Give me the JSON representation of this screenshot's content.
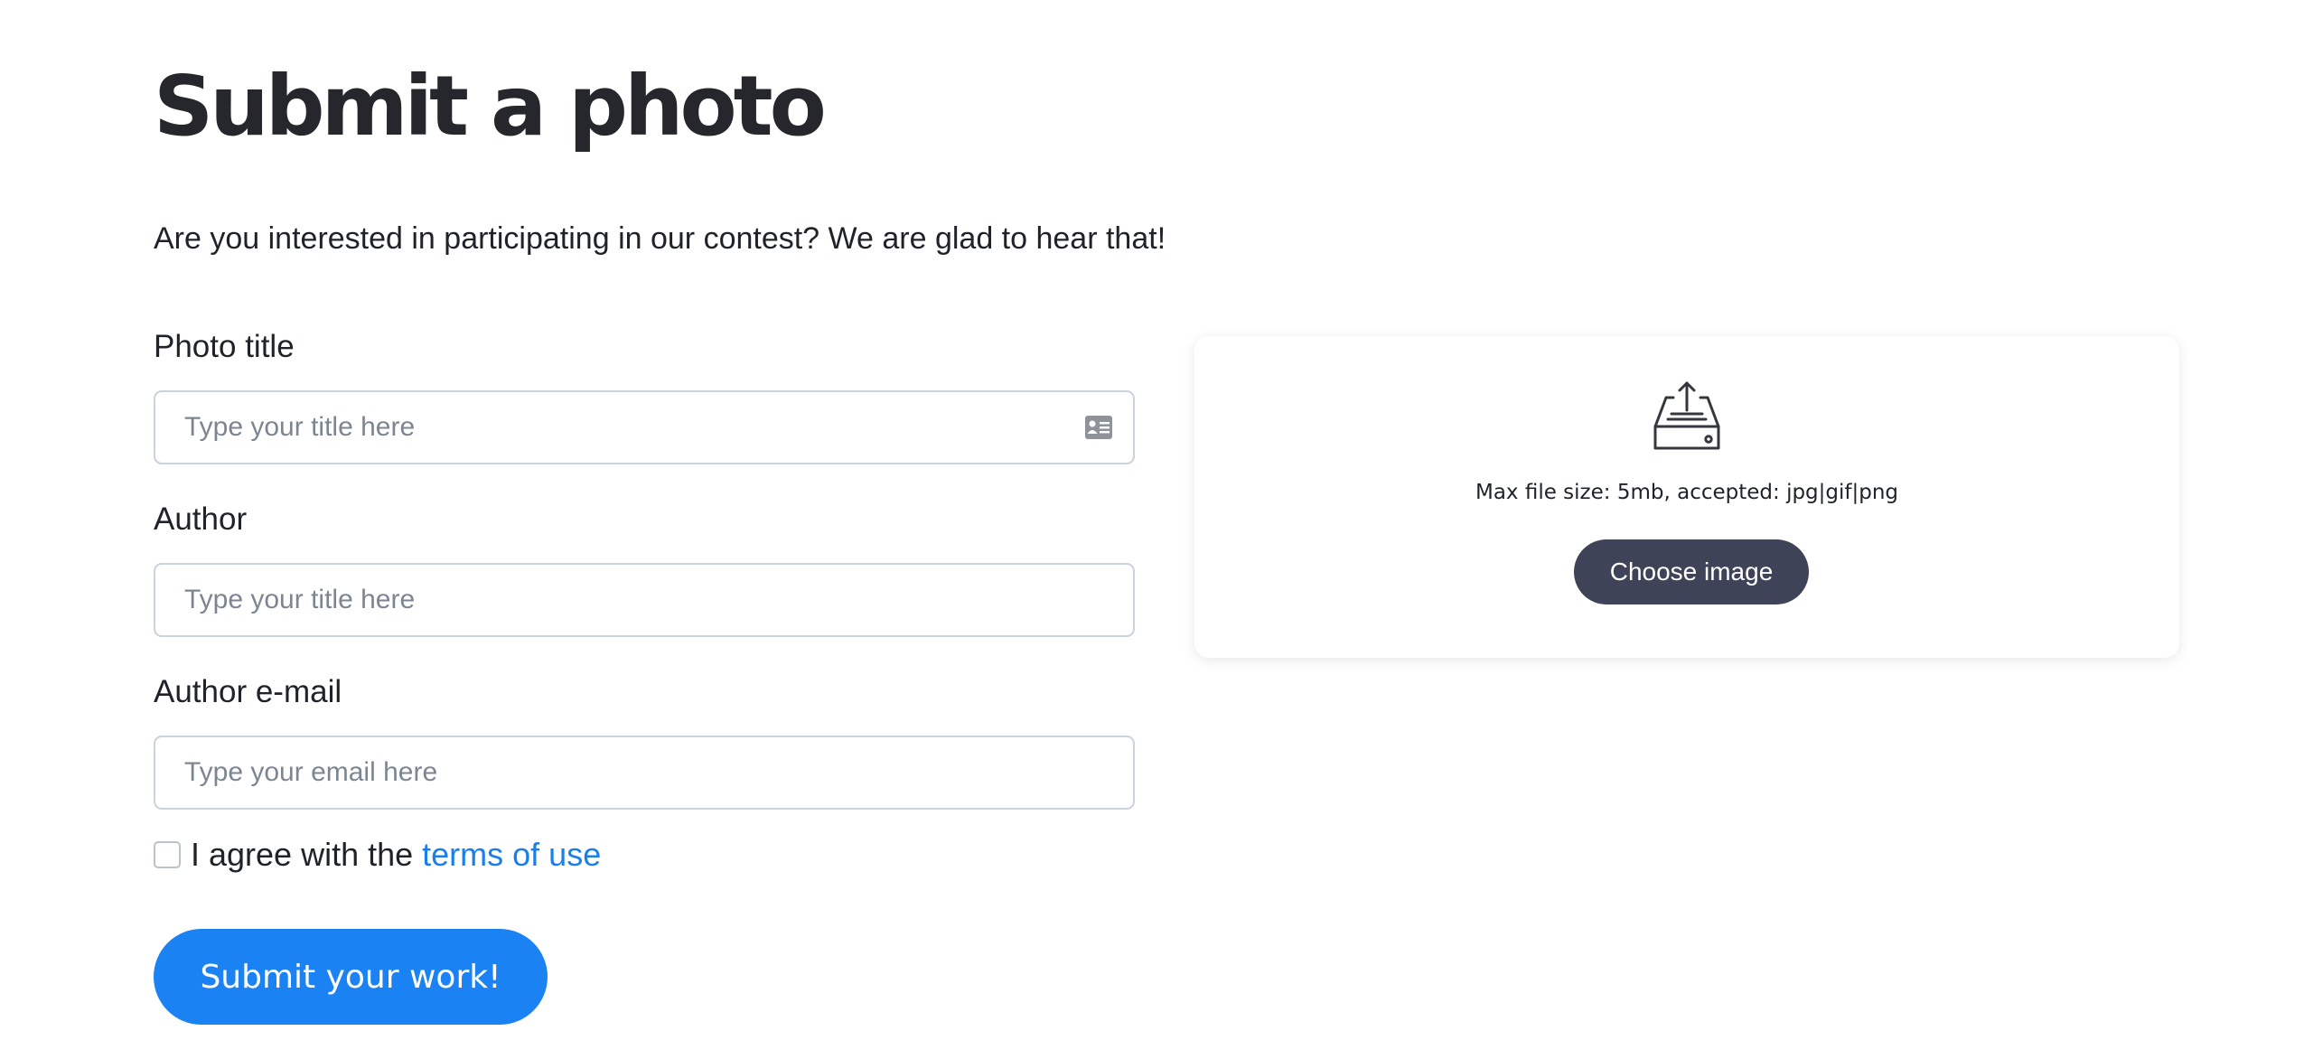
{
  "page": {
    "title": "Submit a photo",
    "intro": "Are you interested in participating in our contest? We are glad to hear that!"
  },
  "form": {
    "photo_title": {
      "label": "Photo title",
      "placeholder": "Type your title here",
      "icon": "id-card-icon"
    },
    "author": {
      "label": "Author",
      "placeholder": "Type your title here"
    },
    "author_email": {
      "label": "Author e-mail",
      "placeholder": "Type your email here"
    },
    "agree": {
      "text": "I agree with the ",
      "link": "terms of use",
      "checked": false
    },
    "submit_label": "Submit your work!"
  },
  "upload": {
    "icon": "inbox-upload-icon",
    "note": "Max file size: 5mb, accepted: jpg|gif|png",
    "button_label": "Choose image"
  },
  "colors": {
    "primary": "#1a82f2",
    "link": "#1a7fe8",
    "dark_button": "#3f4357",
    "heading": "#25272c",
    "input_border": "#c9d2dd"
  }
}
